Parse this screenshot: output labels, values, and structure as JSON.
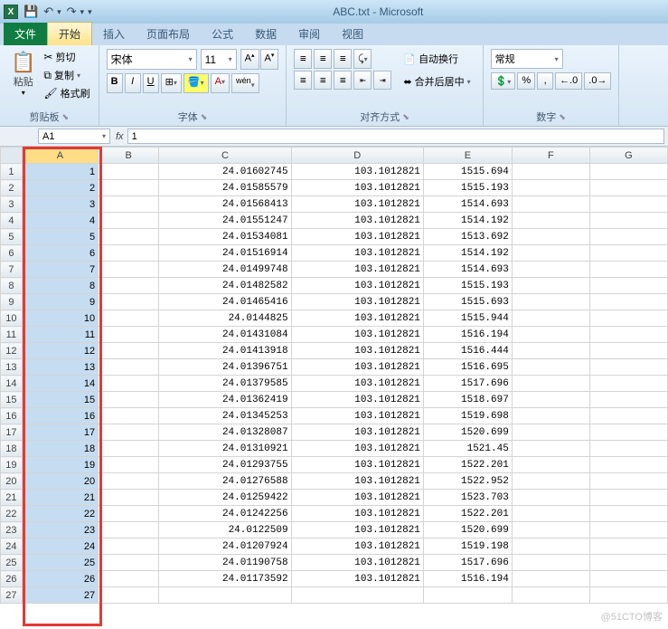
{
  "titlebar": {
    "app_title": "ABC.txt - Microsoft",
    "qat": {
      "save": "💾",
      "undo": "↶",
      "redo": "↷"
    }
  },
  "tabs": {
    "file": "文件",
    "items": [
      "开始",
      "插入",
      "页面布局",
      "公式",
      "数据",
      "审阅",
      "视图"
    ],
    "active": "开始"
  },
  "ribbon": {
    "clipboard": {
      "paste": "粘贴",
      "cut": "剪切",
      "copy": "复制",
      "format_painter": "格式刷",
      "group": "剪贴板"
    },
    "font": {
      "font_name": "宋体",
      "font_size": "11",
      "group": "字体",
      "bold": "B",
      "italic": "I",
      "underline": "U"
    },
    "align": {
      "wrap": "自动换行",
      "merge": "合并后居中",
      "group": "对齐方式"
    },
    "number": {
      "format": "常规",
      "group": "数字"
    }
  },
  "formula_bar": {
    "name_box": "A1",
    "formula": "1"
  },
  "grid": {
    "columns": [
      "A",
      "B",
      "C",
      "D",
      "E",
      "F",
      "G"
    ],
    "rows": [
      {
        "a": "1",
        "c": "24.01602745",
        "d": "103.1012821",
        "e": "1515.694"
      },
      {
        "a": "2",
        "c": "24.01585579",
        "d": "103.1012821",
        "e": "1515.193"
      },
      {
        "a": "3",
        "c": "24.01568413",
        "d": "103.1012821",
        "e": "1514.693"
      },
      {
        "a": "4",
        "c": "24.01551247",
        "d": "103.1012821",
        "e": "1514.192"
      },
      {
        "a": "5",
        "c": "24.01534081",
        "d": "103.1012821",
        "e": "1513.692"
      },
      {
        "a": "6",
        "c": "24.01516914",
        "d": "103.1012821",
        "e": "1514.192"
      },
      {
        "a": "7",
        "c": "24.01499748",
        "d": "103.1012821",
        "e": "1514.693"
      },
      {
        "a": "8",
        "c": "24.01482582",
        "d": "103.1012821",
        "e": "1515.193"
      },
      {
        "a": "9",
        "c": "24.01465416",
        "d": "103.1012821",
        "e": "1515.693"
      },
      {
        "a": "10",
        "c": "24.0144825",
        "d": "103.1012821",
        "e": "1515.944"
      },
      {
        "a": "11",
        "c": "24.01431084",
        "d": "103.1012821",
        "e": "1516.194"
      },
      {
        "a": "12",
        "c": "24.01413918",
        "d": "103.1012821",
        "e": "1516.444"
      },
      {
        "a": "13",
        "c": "24.01396751",
        "d": "103.1012821",
        "e": "1516.695"
      },
      {
        "a": "14",
        "c": "24.01379585",
        "d": "103.1012821",
        "e": "1517.696"
      },
      {
        "a": "15",
        "c": "24.01362419",
        "d": "103.1012821",
        "e": "1518.697"
      },
      {
        "a": "16",
        "c": "24.01345253",
        "d": "103.1012821",
        "e": "1519.698"
      },
      {
        "a": "17",
        "c": "24.01328087",
        "d": "103.1012821",
        "e": "1520.699"
      },
      {
        "a": "18",
        "c": "24.01310921",
        "d": "103.1012821",
        "e": "1521.45"
      },
      {
        "a": "19",
        "c": "24.01293755",
        "d": "103.1012821",
        "e": "1522.201"
      },
      {
        "a": "20",
        "c": "24.01276588",
        "d": "103.1012821",
        "e": "1522.952"
      },
      {
        "a": "21",
        "c": "24.01259422",
        "d": "103.1012821",
        "e": "1523.703"
      },
      {
        "a": "22",
        "c": "24.01242256",
        "d": "103.1012821",
        "e": "1522.201"
      },
      {
        "a": "23",
        "c": "24.0122509",
        "d": "103.1012821",
        "e": "1520.699"
      },
      {
        "a": "24",
        "c": "24.01207924",
        "d": "103.1012821",
        "e": "1519.198"
      },
      {
        "a": "25",
        "c": "24.01190758",
        "d": "103.1012821",
        "e": "1517.696"
      },
      {
        "a": "26",
        "c": "24.01173592",
        "d": "103.1012821",
        "e": "1516.194"
      },
      {
        "a": "27",
        "c": "",
        "d": "",
        "e": ""
      }
    ]
  },
  "watermark": "@51CTO博客"
}
